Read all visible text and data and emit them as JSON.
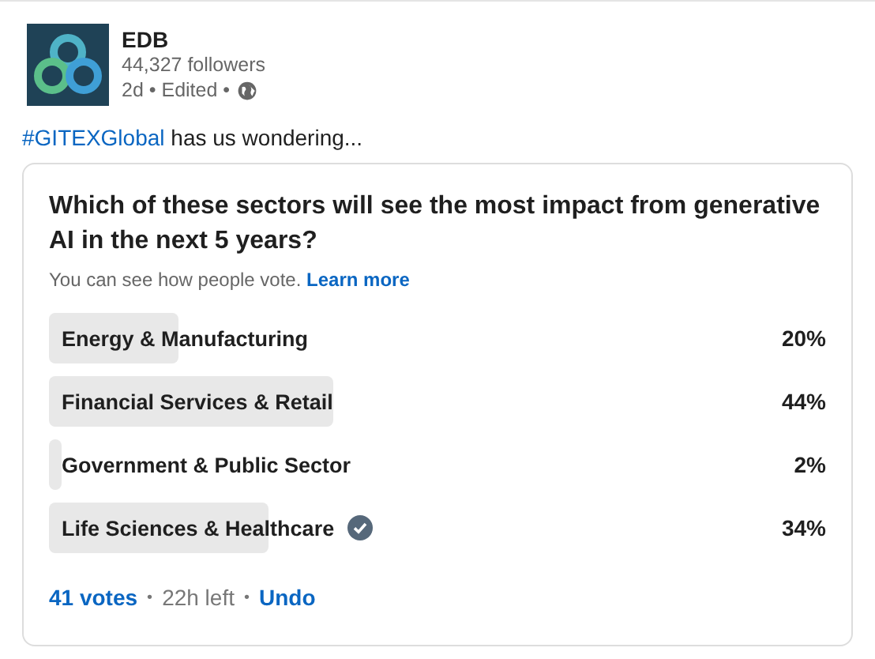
{
  "post": {
    "author": "EDB",
    "followers": "44,327 followers",
    "meta": "2d • Edited •",
    "hashtag": "#GITEXGlobal",
    "text": " has us wondering..."
  },
  "poll": {
    "question": "Which of these sectors will see the most impact from generative AI in the next 5 years?",
    "note": "You can see how people vote.",
    "note_link": "Learn more",
    "options": [
      {
        "label": "Energy & Manufacturing",
        "percent": "20%",
        "selected": false
      },
      {
        "label": "Financial Services & Retail",
        "percent": "44%",
        "selected": false
      },
      {
        "label": "Government & Public Sector",
        "percent": "2%",
        "selected": false
      },
      {
        "label": "Life Sciences & Healthcare",
        "percent": "34%",
        "selected": true
      }
    ],
    "votes": "41 votes",
    "separator_1": "•",
    "time_left": "22h left",
    "separator_2": "•",
    "undo": "Undo"
  }
}
